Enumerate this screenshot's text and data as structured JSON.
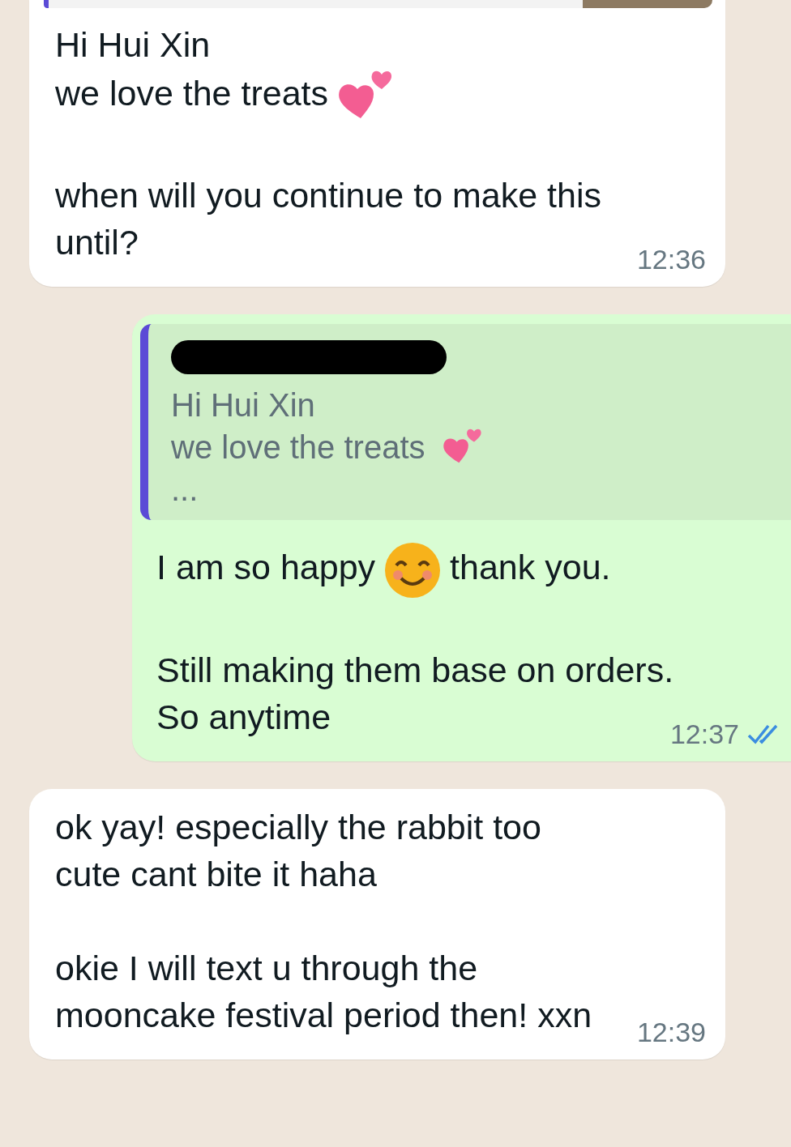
{
  "messages": [
    {
      "outgoing": false,
      "quote": {
        "kind": "clipped"
      },
      "paragraphs": [
        [
          [
            {
              "kind": "text",
              "text": "Hi Hui Xin"
            }
          ],
          [
            {
              "kind": "text",
              "text": "we love the treats"
            },
            {
              "kind": "hearts"
            }
          ]
        ],
        [
          [
            {
              "kind": "text",
              "text": "when will you continue to make this"
            }
          ],
          [
            {
              "kind": "text",
              "text": "until?"
            }
          ]
        ]
      ],
      "time": "12:36"
    },
    {
      "outgoing": true,
      "quote": {
        "kind": "full",
        "sender_redacted": true,
        "lines": [
          [
            {
              "kind": "text",
              "text": "Hi Hui Xin"
            }
          ],
          [
            {
              "kind": "text",
              "text": "we love the treats"
            },
            {
              "kind": "hearts"
            }
          ],
          [
            {
              "kind": "text",
              "text": "..."
            }
          ]
        ]
      },
      "paragraphs": [
        [
          [
            {
              "kind": "text",
              "text": "I am so happy"
            },
            {
              "kind": "smile"
            },
            {
              "kind": "text",
              "text": "thank you."
            }
          ]
        ],
        [
          [
            {
              "kind": "text",
              "text": "Still making them base on orders."
            }
          ],
          [
            {
              "kind": "text",
              "text": "So anytime"
            }
          ]
        ]
      ],
      "time": "12:37",
      "read": true
    },
    {
      "outgoing": false,
      "paragraphs": [
        [
          [
            {
              "kind": "text",
              "text": "ok yay! especially the rabbit too"
            }
          ],
          [
            {
              "kind": "text",
              "text": "cute cant bite it haha"
            }
          ]
        ],
        [
          [
            {
              "kind": "text",
              "text": "okie I will text u through the"
            }
          ],
          [
            {
              "kind": "text",
              "text": "mooncake festival period then! xxn"
            }
          ]
        ]
      ],
      "time": "12:39"
    }
  ]
}
